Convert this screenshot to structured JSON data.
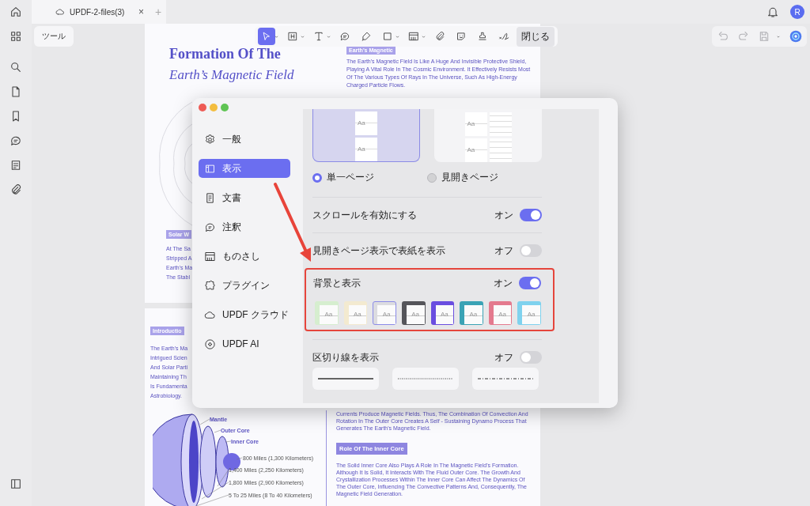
{
  "tabs": [
    {
      "label": "UPDF-2-files(3)"
    }
  ],
  "tab_close": "×",
  "tab_add": "+",
  "avatar": "R",
  "tools_button": "ツール",
  "toolbar": {
    "tools": [
      {
        "selected": true,
        "dropdown": true
      },
      {
        "selected": false,
        "dropdown": true
      },
      {
        "selected": false,
        "dropdown": true
      },
      {
        "selected": false,
        "dropdown": false
      },
      {
        "selected": false,
        "dropdown": false
      },
      {
        "selected": false,
        "dropdown": true
      },
      {
        "selected": false,
        "dropdown": true
      },
      {
        "selected": false,
        "dropdown": false
      },
      {
        "selected": false,
        "dropdown": false
      },
      {
        "selected": false,
        "dropdown": false
      },
      {
        "selected": false,
        "dropdown": false
      }
    ],
    "close": "閉じる"
  },
  "page_1": {
    "title": "Formation Of The",
    "subtitle": "Earth’s Magnetic Field",
    "heading": "Earth's Magnetic",
    "paragraph": "The Earth's Magnetic Field Is Like A Huge And Invisible Protective Shield, Playing A Vital Role In The Cosmic Environment. It Effectively Resists Most Of The Various Types Of Rays In The Universe, Such As High-Energy Charged Particle Flows.",
    "side_heading": "Solar W",
    "side_lines": [
      "At The Sa",
      "Stripped A",
      "Earth's Ma",
      "The Stabl"
    ]
  },
  "page_2": {
    "heading": "Introductio",
    "lines": [
      "The Earth's Ma",
      "Intrigued Scien",
      "And Solar Parti",
      "Maintaining Th",
      "Is Fundamenta",
      "Astrobiology."
    ],
    "diagram": {
      "layers": [
        "Mantle",
        "Outer Core",
        "Inner Core"
      ],
      "distances": [
        "800 Miles (1,300 Kilometers)",
        "1,400 Miles (2,250 Kilometers)",
        "1,800 Miles (2,900 Kilometers)",
        "5 To 25 Miles (8 To 40 Kilometers)"
      ]
    },
    "paragraph_1": "Currents Produce Magnetic Fields. Thus, The Combination Of Convection And Rotation In The Outer Core Creates A Self - Sustaining Dynamo Process That Generates The Earth's Magnetic Field.",
    "heading_2": "Role Of The Inner Core",
    "paragraph_2": "The Solid Inner Core Also Plays A Role In The Magnetic Field's Formation. Although It Is Solid, It Interacts With The Fluid Outer Core. The Growth And Crystallization Processes Within The Inner Core Can Affect The Dynamics Of The Outer Core, Influencing The Convective Patterns And, Consequently, The Magnetic Field Generation."
  },
  "dialog": {
    "sidebar": [
      {
        "label": "一般",
        "selected": false
      },
      {
        "label": "表示",
        "selected": true
      },
      {
        "label": "文書",
        "selected": false
      },
      {
        "label": "注釈",
        "selected": false
      },
      {
        "label": "ものさし",
        "selected": false
      },
      {
        "label": "プラグイン",
        "selected": false
      },
      {
        "label": "UPDF クラウド",
        "selected": false
      },
      {
        "label": "UPDF AI",
        "selected": false
      }
    ],
    "layouts": [
      {
        "label": "単一ページ",
        "kind": "single",
        "selected": true,
        "page_labels": [
          "Aa",
          "Aa"
        ]
      },
      {
        "label": "見開きページ",
        "kind": "spread",
        "selected": false,
        "page_labels": [
          "Aa",
          "Aa"
        ]
      }
    ],
    "settings": [
      {
        "label": "スクロールを有効にする",
        "state_label": "オン",
        "on": true
      },
      {
        "label": "見開きページ表示で表紙を表示",
        "state_label": "オフ",
        "on": false
      },
      {
        "label": "背景と表示",
        "state_label": "オン",
        "on": true,
        "highlighted": true,
        "themes": [
          {
            "color": "#d6eecf",
            "label": "Aa",
            "selected": false
          },
          {
            "color": "#f3ead0",
            "label": "Aa",
            "selected": false
          },
          {
            "color": "#dcdce0",
            "label": "Aa",
            "selected": true
          },
          {
            "color": "#55555a",
            "label": "Aa",
            "selected": false
          },
          {
            "color": "#6a4ee0",
            "label": "Aa",
            "selected": false
          },
          {
            "color": "#3aa3b5",
            "label": "Aa",
            "selected": false
          },
          {
            "color": "#e47a8e",
            "label": "Aa",
            "selected": false
          },
          {
            "color": "#7fd2ee",
            "label": "Aa",
            "selected": false
          }
        ]
      },
      {
        "label": "区切り線を表示",
        "state_label": "オフ",
        "on": false,
        "line_styles": [
          {
            "kind": "solid"
          },
          {
            "kind": "dotted"
          },
          {
            "kind": "dashdot"
          }
        ]
      }
    ]
  }
}
